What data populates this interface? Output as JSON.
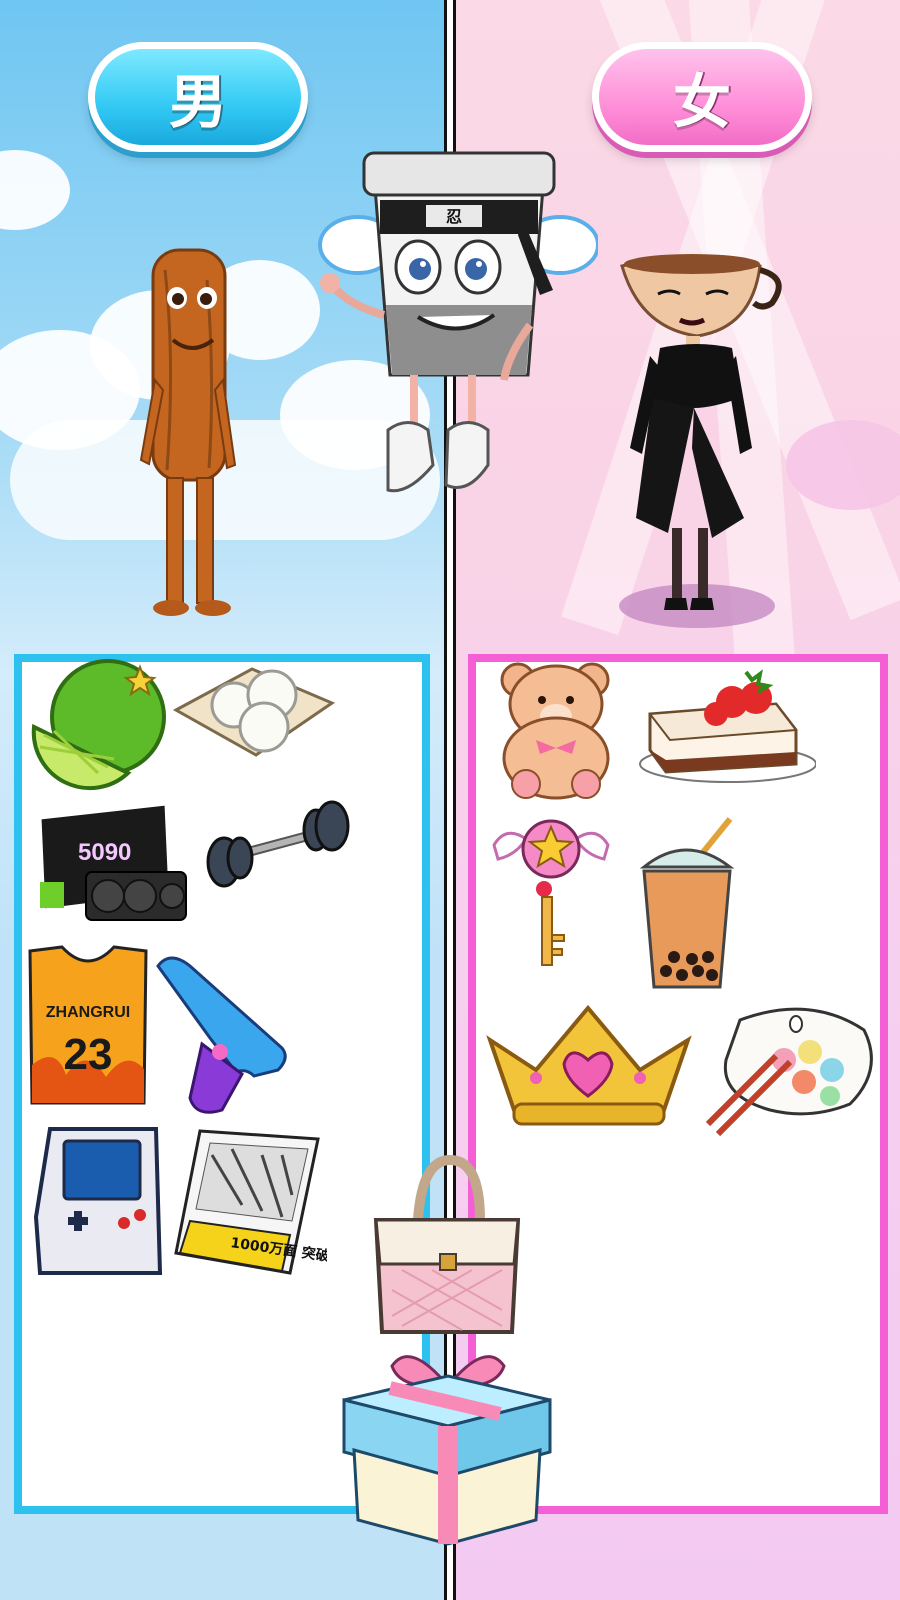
{
  "tabs": {
    "male": {
      "label": "男",
      "color": "#32c9f4"
    },
    "female": {
      "label": "女",
      "color": "#ff8fd8"
    }
  },
  "characters": {
    "center_headband_text": "忍"
  },
  "male_items": {
    "gpu_text": "5090",
    "jersey_name": "ZHANGRUI",
    "jersey_number": "23",
    "book_title": "1000万面 突破"
  },
  "colors": {
    "male_panel_border": "#2cc1ef",
    "female_panel_border": "#f55fd6"
  }
}
